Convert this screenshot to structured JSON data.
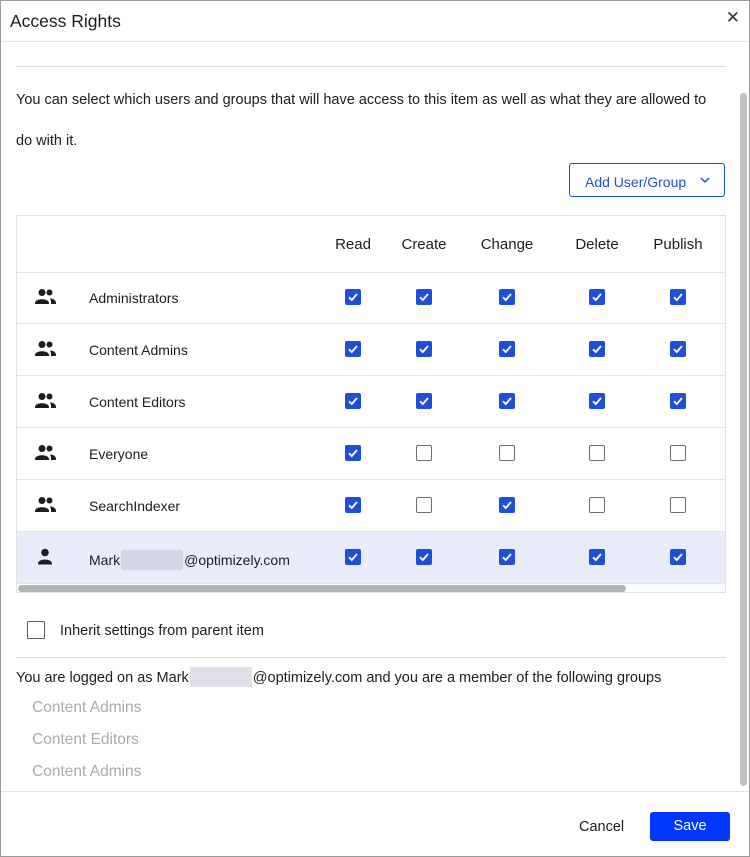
{
  "dialog": {
    "title": "Access Rights",
    "close_glyph": "✕",
    "intro": "You can select which users and groups that will have access to this item as well as what they are allowed to do with it.",
    "add_button": "Add User/Group"
  },
  "grid": {
    "columns": [
      "Read",
      "Create",
      "Change",
      "Delete",
      "Publish"
    ],
    "rows": [
      {
        "type": "group",
        "icon": "group-icon",
        "name_pre": "Administrators",
        "name_post": "",
        "masked": false,
        "perms": [
          true,
          true,
          true,
          true,
          true
        ],
        "selected": false
      },
      {
        "type": "group",
        "icon": "group-icon",
        "name_pre": "Content Admins",
        "name_post": "",
        "masked": false,
        "perms": [
          true,
          true,
          true,
          true,
          true
        ],
        "selected": false
      },
      {
        "type": "group",
        "icon": "group-icon",
        "name_pre": "Content Editors",
        "name_post": "",
        "masked": false,
        "perms": [
          true,
          true,
          true,
          true,
          true
        ],
        "selected": false
      },
      {
        "type": "group",
        "icon": "group-icon",
        "name_pre": "Everyone",
        "name_post": "",
        "masked": false,
        "perms": [
          true,
          false,
          false,
          false,
          false
        ],
        "selected": false
      },
      {
        "type": "group",
        "icon": "group-icon",
        "name_pre": "SearchIndexer",
        "name_post": "",
        "masked": false,
        "perms": [
          true,
          false,
          true,
          false,
          false
        ],
        "selected": false
      },
      {
        "type": "user",
        "icon": "user-icon",
        "name_pre": "Mark",
        "name_post": "@optimizely.com",
        "masked": true,
        "perms": [
          true,
          true,
          true,
          true,
          true
        ],
        "selected": true
      }
    ]
  },
  "inherit": {
    "label": "Inherit settings from parent item",
    "checked": false
  },
  "session": {
    "pre": "You are logged on as Mark",
    "post": "@optimizely.com and you are a member of the following groups",
    "groups": [
      "Content Admins",
      "Content Editors",
      "Content Admins"
    ]
  },
  "footer": {
    "cancel": "Cancel",
    "save": "Save"
  },
  "colors": {
    "accent": "#1f4fd6",
    "save_bg": "#0037ff",
    "selected_row": "#e9edfb"
  }
}
